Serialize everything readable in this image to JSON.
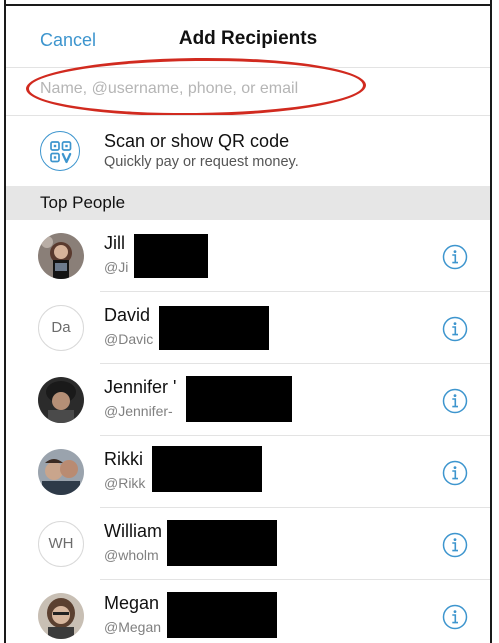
{
  "header": {
    "cancel_label": "Cancel",
    "title": "Add Recipients"
  },
  "search": {
    "placeholder": "Name, @username, phone, or email",
    "value": ""
  },
  "qr": {
    "title": "Scan or show QR code",
    "subtitle": "Quickly pay or request money."
  },
  "section": {
    "label": "Top People"
  },
  "people": [
    {
      "name": "Jill",
      "handle": "@Ji",
      "avatar": "photo",
      "initials": ""
    },
    {
      "name": "David",
      "handle": "@Davic",
      "avatar": "initials",
      "initials": "Da"
    },
    {
      "name": "Jennifer '",
      "handle": "@Jennifer-",
      "avatar": "photo",
      "initials": ""
    },
    {
      "name": "Rikki",
      "handle": "@Rikk",
      "avatar": "photo",
      "initials": ""
    },
    {
      "name": "William",
      "handle": "@wholm",
      "avatar": "initials",
      "initials": "WH"
    },
    {
      "name": "Megan",
      "handle": "@Megan",
      "avatar": "photo",
      "initials": ""
    }
  ],
  "icons": {
    "qr": "qr-code-icon",
    "info": "info-icon"
  },
  "colors": {
    "accent": "#3d95ce",
    "highlight": "#d12a1f",
    "section_bg": "#e6e6e6",
    "redaction": "#000000"
  }
}
